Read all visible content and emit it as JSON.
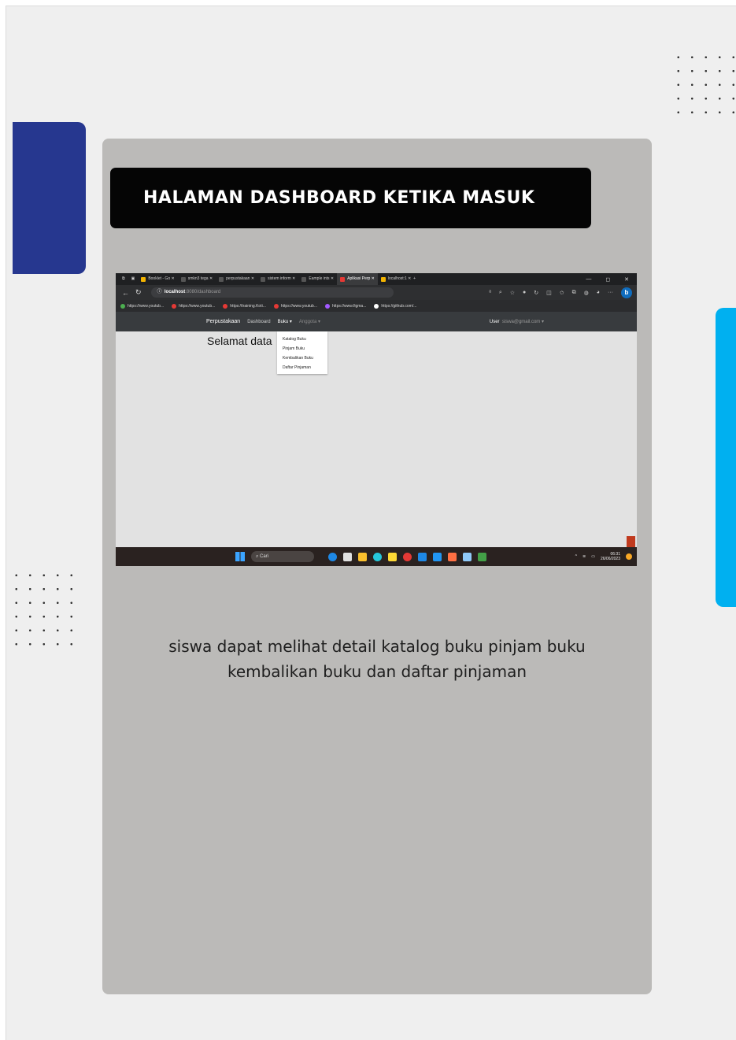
{
  "document": {
    "title": "HALAMAN DASHBOARD KETIKA MASUK",
    "caption_line1": "siswa dapat melihat detail katalog buku pinjam buku",
    "caption_line2": "kembalikan buku dan daftar pinjaman"
  },
  "colors": {
    "left_accent": "#26378f",
    "right_accent": "#00b0f0",
    "card": "#bbbab8",
    "title_bar": "#050505"
  },
  "screenshot": {
    "tabs": [
      {
        "label": "Booklet - Go"
      },
      {
        "label": "smkn3 tega"
      },
      {
        "label": "perpustakaan"
      },
      {
        "label": "sistem inform"
      },
      {
        "label": "Eample ints"
      },
      {
        "label": "Aplikasi Perp"
      },
      {
        "label": "localhost:1"
      }
    ],
    "url_host": "localhost",
    "url_path": ":8080/dashboard",
    "bookmarks": [
      {
        "label": "https://www.youtub..."
      },
      {
        "label": "https://www.youtub..."
      },
      {
        "label": "https://training.Koti..."
      },
      {
        "label": "https://www.youtub..."
      },
      {
        "label": "https://www.figma..."
      },
      {
        "label": "https://github.com/..."
      }
    ],
    "app_nav": {
      "brand": "Perpustakaan",
      "dashboard": "Dashboard",
      "buku": "Buku ▾",
      "anggota": "Anggota ▾",
      "user_role": "User",
      "user_email": "siswa@gmail.com ▾"
    },
    "welcome": "Selamat data",
    "dropdown_items": [
      "Katalog Buku",
      "Pinjam Buku",
      "Kembalikan Buku",
      "Daftar Pinjaman"
    ],
    "taskbar": {
      "search_label": "Cari",
      "time": "06:31",
      "date": "26/06/2023"
    }
  }
}
